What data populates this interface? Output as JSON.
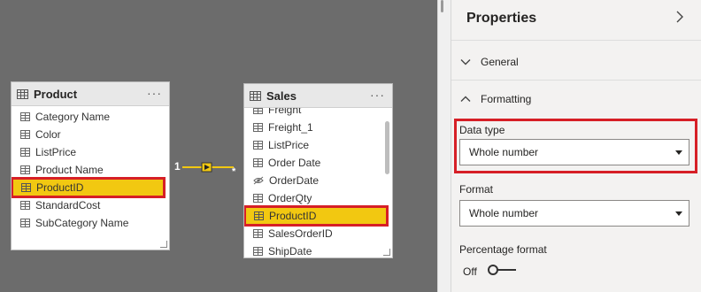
{
  "model": {
    "tables": [
      {
        "name": "Product",
        "fields": [
          "Category Name",
          "Color",
          "ListPrice",
          "Product Name",
          "ProductID",
          "StandardCost",
          "SubCategory Name"
        ],
        "selected_field": "ProductID"
      },
      {
        "name": "Sales",
        "fields": [
          "Freight",
          "Freight_1",
          "ListPrice",
          "Order Date",
          "OrderDate",
          "OrderQty",
          "ProductID",
          "SalesOrderID",
          "ShipDate"
        ],
        "selected_field": "ProductID",
        "hidden_field": "OrderDate"
      }
    ],
    "relationship": {
      "from_cardinality": "1",
      "to_cardinality": "*"
    },
    "more_menu": "···"
  },
  "properties": {
    "title": "Properties",
    "sections": {
      "general": "General",
      "formatting": "Formatting"
    },
    "data_type": {
      "label": "Data type",
      "value": "Whole number"
    },
    "format": {
      "label": "Format",
      "value": "Whole number"
    },
    "percentage_format": {
      "label": "Percentage format",
      "toggle_state": "Off"
    }
  },
  "colors": {
    "canvas": "#6c6c6c",
    "selection": "#f2c811",
    "highlight_border": "#d61f26",
    "pane_bg": "#f3f2f1"
  },
  "icons": [
    "table-icon",
    "column-icon",
    "hidden-column-icon",
    "chevron-right-icon",
    "chevron-down-icon",
    "chevron-up-icon",
    "caret-down-icon",
    "toggle-off-icon"
  ]
}
